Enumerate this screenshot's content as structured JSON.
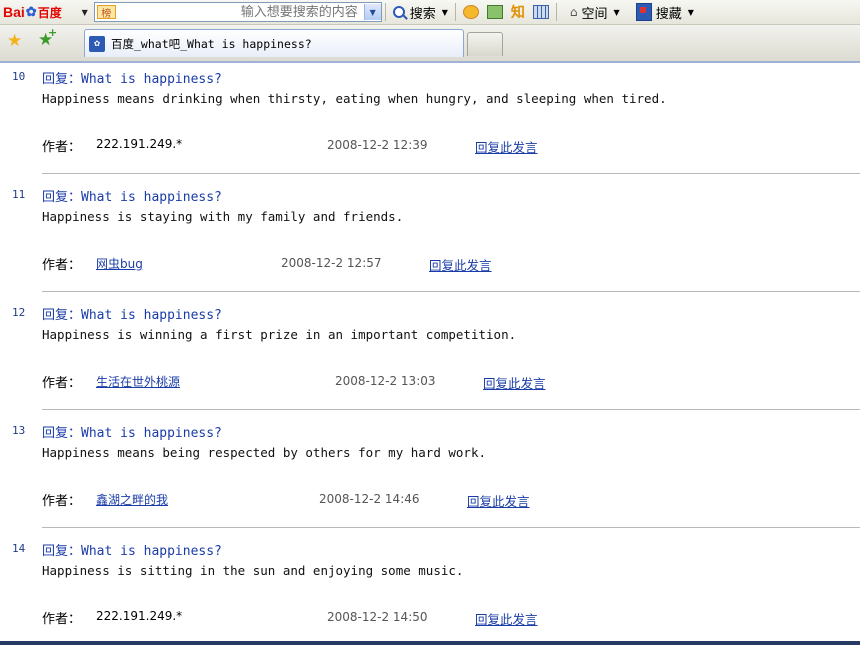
{
  "toolbar": {
    "logo_bai": "Bai",
    "logo_du": "百度",
    "hot_badge": "榜",
    "search_placeholder": "输入想要搜索的内容",
    "search_button": "搜索",
    "zhi_label": "知",
    "space_button": "空间",
    "favorites_button": "搜藏"
  },
  "tab": {
    "title": "百度_what吧_What is happiness?"
  },
  "posts": [
    {
      "number": "10",
      "title": "回复：What is happiness?",
      "body": "Happiness means drinking when thirsty, eating when hungry, and sleeping when tired.",
      "author_label": "作者：",
      "author": "222.191.249.*",
      "time": "2008-12-2 12:39",
      "reply": "回复此发言"
    },
    {
      "number": "11",
      "title": "回复：What is happiness?",
      "body": "Happiness is staying with my family and friends.",
      "author_label": "作者：",
      "author": "网虫bug",
      "time": "2008-12-2 12:57",
      "reply": "回复此发言"
    },
    {
      "number": "12",
      "title": "回复：What is happiness?",
      "body": "Happiness is winning a first prize in an important competition.",
      "author_label": "作者：",
      "author": "生活在世外桃源",
      "time": "2008-12-2 13:03",
      "reply": "回复此发言"
    },
    {
      "number": "13",
      "title": "回复：What is happiness?",
      "body": "Happiness means being respected by others for my hard work.",
      "author_label": "作者：",
      "author": "鑫湖之畔的我",
      "time": "2008-12-2 14:46",
      "reply": "回复此发言"
    },
    {
      "number": "14",
      "title": "回复：What is happiness?",
      "body": "Happiness is sitting in the sun and enjoying some music.",
      "author_label": "作者：",
      "author": "222.191.249.*",
      "time": "2008-12-2 14:50",
      "reply": "回复此发言"
    }
  ],
  "colors": {
    "link": "#1a3ca8",
    "brand_red": "#e10602",
    "divider": "#b9b9b9"
  }
}
